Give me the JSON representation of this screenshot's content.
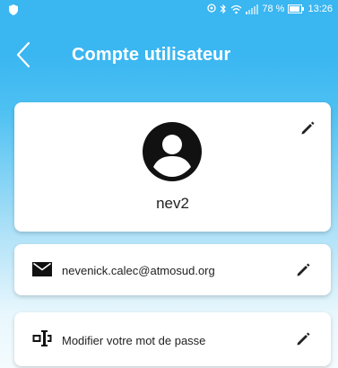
{
  "status_bar": {
    "battery_text": "78 %",
    "time": "13:26",
    "icons": [
      "shield-icon",
      "location-icon",
      "bluetooth-icon",
      "wifi-icon",
      "signal-icon",
      "battery-icon"
    ]
  },
  "header": {
    "title": "Compte utilisateur",
    "back_icon": "chevron-left-icon"
  },
  "profile": {
    "username": "nev2",
    "avatar_icon": "account-circle-icon",
    "edit_icon": "pencil-icon"
  },
  "email": {
    "value": "nevenick.calec@atmosud.org",
    "icon": "mail-icon",
    "edit_icon": "pencil-icon"
  },
  "password": {
    "label": "Modifier votre mot de passe",
    "icon": "password-field-icon",
    "edit_icon": "pencil-icon"
  },
  "colors": {
    "header_blue": "#3ab6f1",
    "text": "#222222",
    "card": "#ffffff"
  }
}
